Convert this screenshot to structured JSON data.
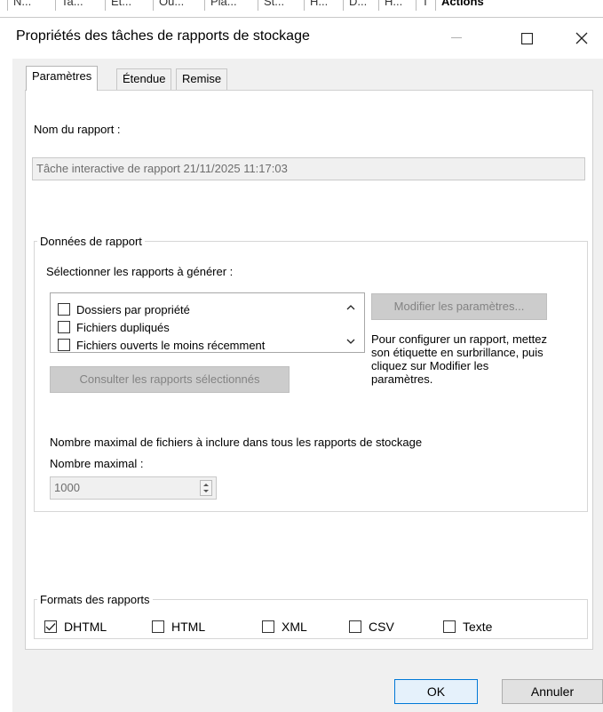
{
  "background_header": {
    "columns": [
      "N...",
      "Ta...",
      "Et...",
      "Ou...",
      "Pla...",
      "St...",
      "H...",
      "D...",
      "H...",
      "T",
      "Actions"
    ]
  },
  "dialog": {
    "title": "Propriétés des tâches de rapports de stockage",
    "window_buttons": {
      "minimize": "—",
      "maximize": "☐",
      "close": "✕"
    },
    "tabs": [
      {
        "label": "Paramètres",
        "active": true
      },
      {
        "label": "Étendue",
        "active": false
      },
      {
        "label": "Remise",
        "active": false
      }
    ],
    "report_name_label": "Nom du rapport :",
    "report_name_value": "Tâche interactive de rapport 21/11/2025 11:17:03",
    "report_data": {
      "legend": "Données de rapport",
      "select_label": "Sélectionner les rapports à générer :",
      "reports": [
        {
          "label": "Dossiers par propriété",
          "checked": false
        },
        {
          "label": "Fichiers dupliqués",
          "checked": false
        },
        {
          "label": "Fichiers ouverts le moins récemment",
          "checked": false
        }
      ],
      "modify_button": "Modifier les paramètres...",
      "view_button": "Consulter les rapports sélectionnés",
      "help_text": "Pour configurer un rapport, mettez son étiquette en surbrillance, puis cliquez sur Modifier les paramètres.",
      "max_files_label": "Nombre maximal de fichiers à inclure dans tous les rapports de stockage",
      "max_label": "Nombre maximal :",
      "max_value": "1000"
    },
    "formats": {
      "legend": "Formats des rapports",
      "items": [
        {
          "label": "DHTML",
          "checked": true
        },
        {
          "label": "HTML",
          "checked": false
        },
        {
          "label": "XML",
          "checked": false
        },
        {
          "label": "CSV",
          "checked": false
        },
        {
          "label": "Texte",
          "checked": false
        }
      ]
    },
    "ok_button": "OK",
    "cancel_button": "Annuler"
  },
  "colors": {
    "dialog_bg": "#f0f0f0",
    "panel_bg": "#ffffff",
    "disabled_button": "#cccccc",
    "ok_border": "#0078d7"
  }
}
